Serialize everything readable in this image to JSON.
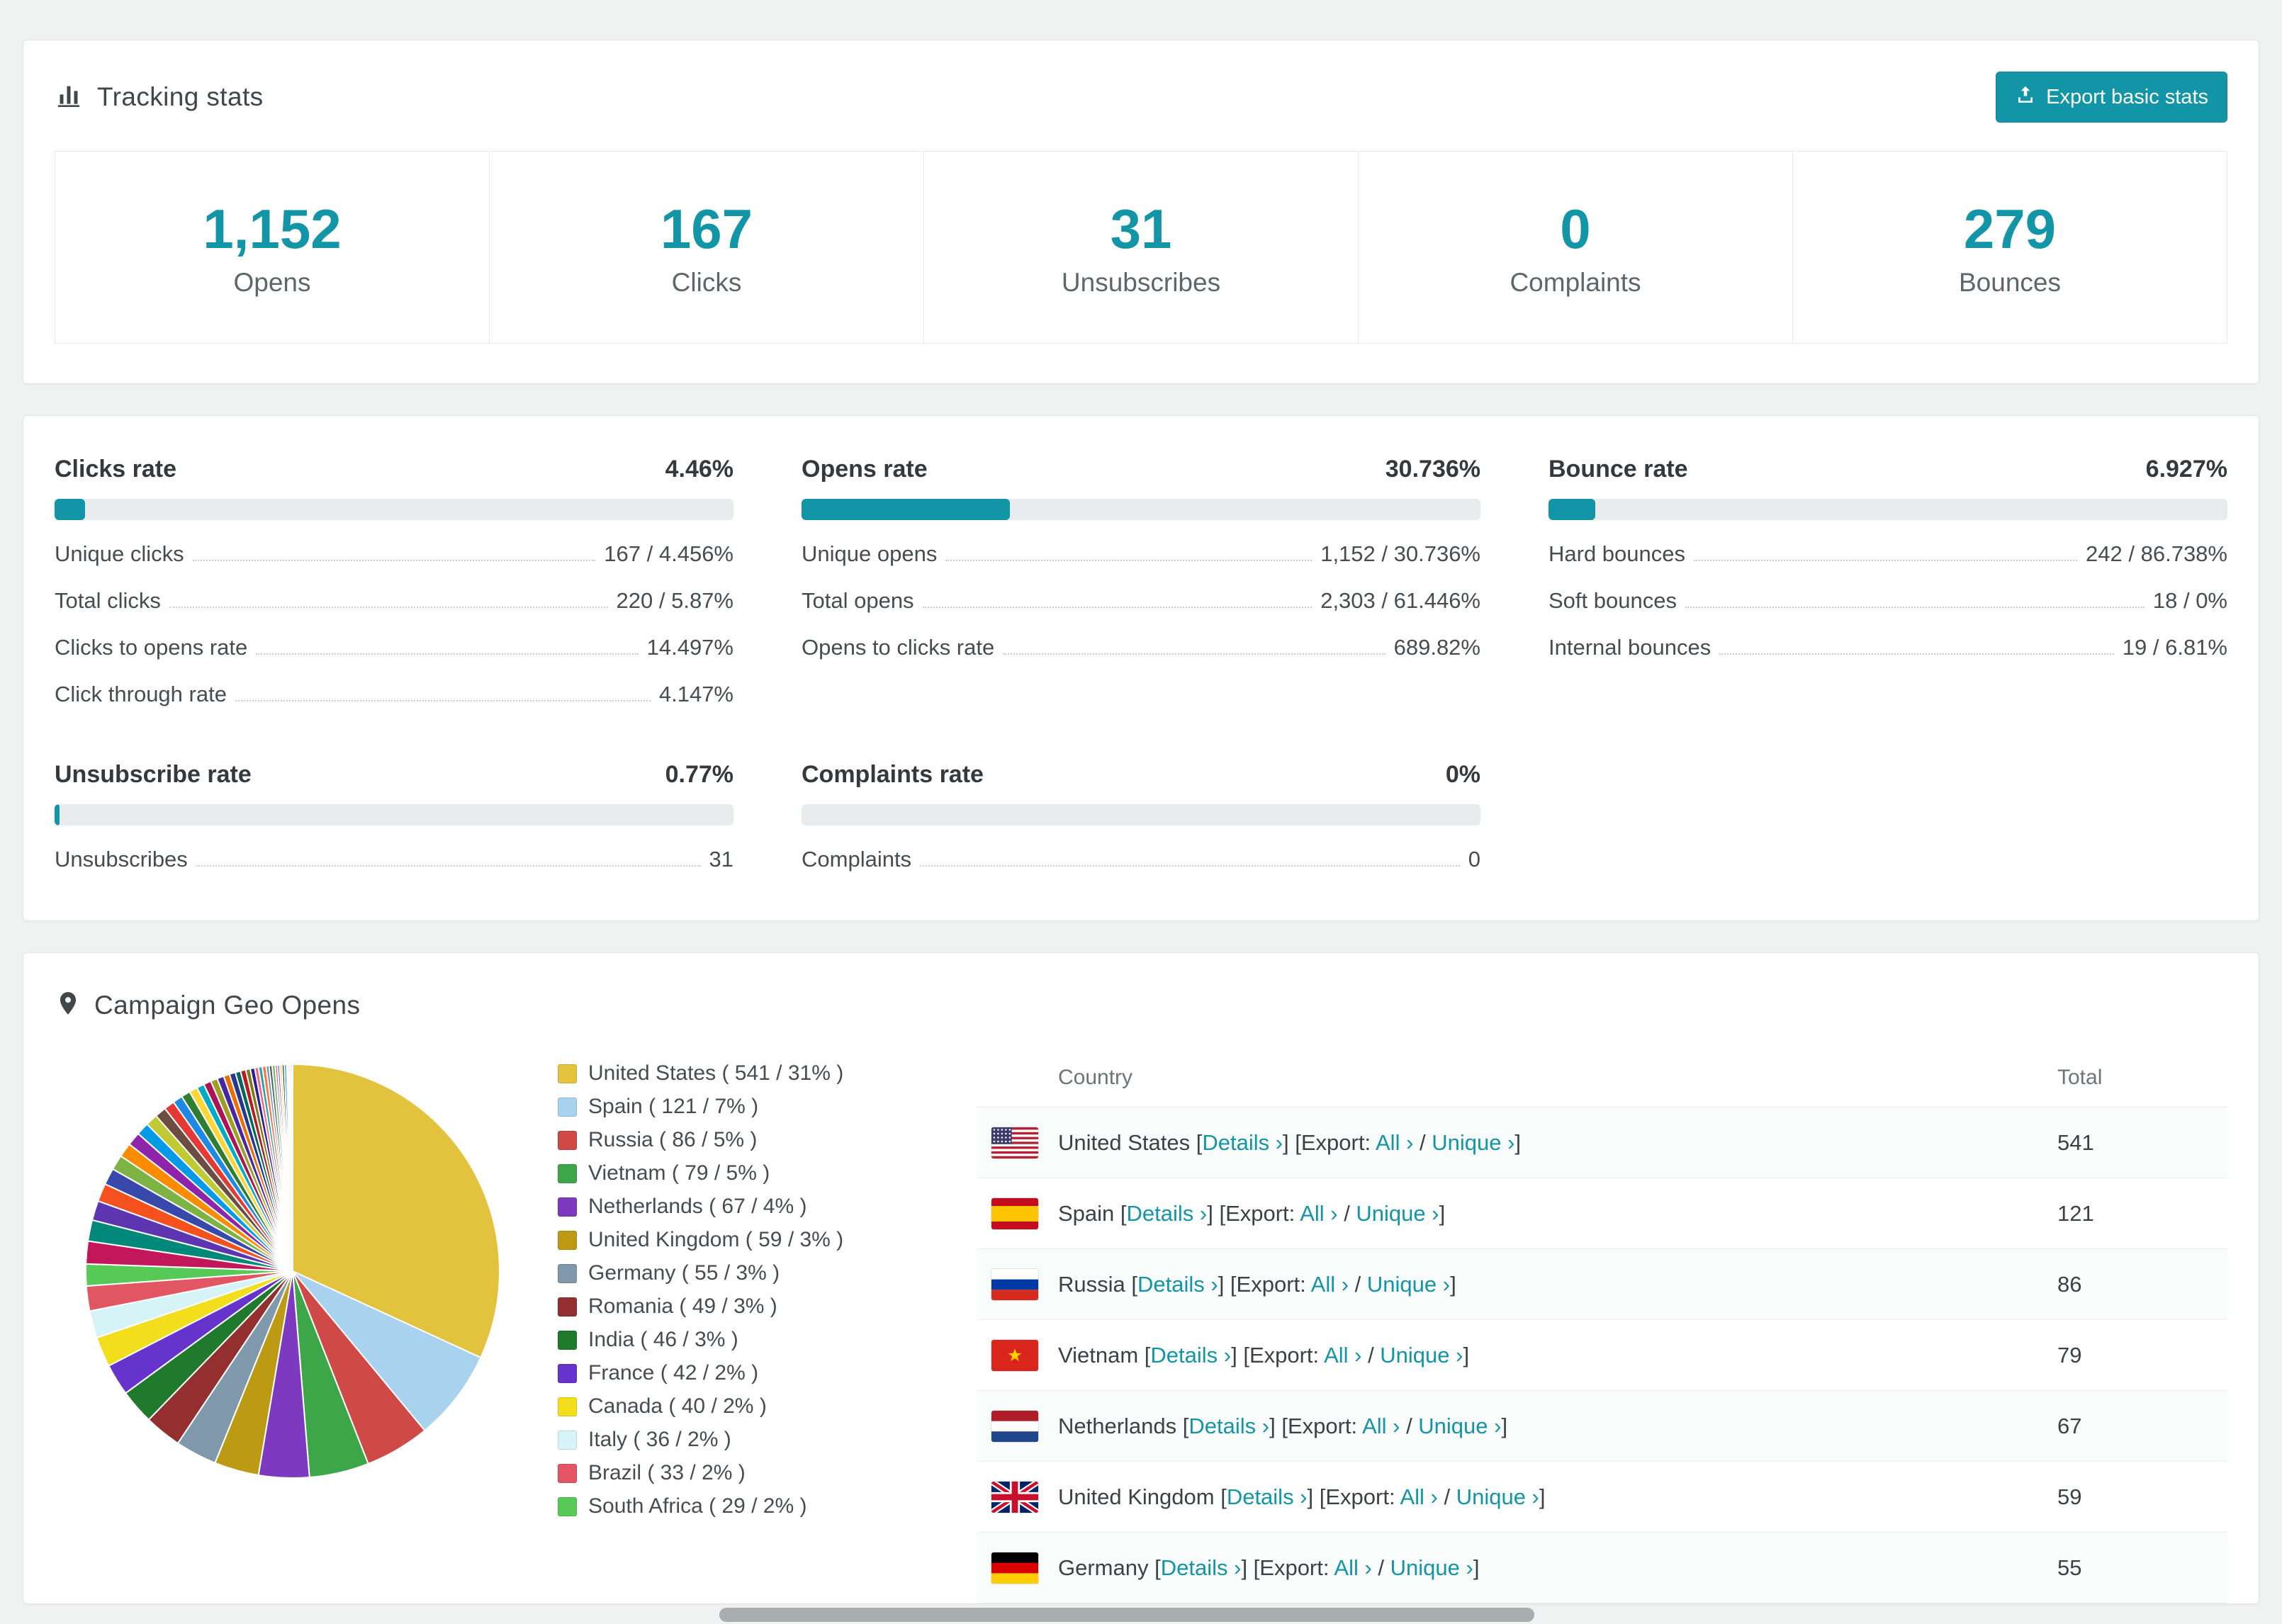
{
  "theme": {
    "accent": "#1295a6",
    "text_dark": "#3b4246",
    "text_muted": "#5d676b",
    "bar_track": "#e9eced"
  },
  "tracking": {
    "title": "Tracking stats",
    "export_label": "Export basic stats",
    "stats": [
      {
        "value": "1,152",
        "label": "Opens"
      },
      {
        "value": "167",
        "label": "Clicks"
      },
      {
        "value": "31",
        "label": "Unsubscribes"
      },
      {
        "value": "0",
        "label": "Complaints"
      },
      {
        "value": "279",
        "label": "Bounces"
      }
    ]
  },
  "rates": [
    {
      "title": "Clicks rate",
      "value": "4.46%",
      "percent": 4.46,
      "rows": [
        {
          "label": "Unique clicks",
          "value": "167 / 4.456%"
        },
        {
          "label": "Total clicks",
          "value": "220 / 5.87%"
        },
        {
          "label": "Clicks to opens rate",
          "value": "14.497%"
        },
        {
          "label": "Click through rate",
          "value": "4.147%"
        }
      ]
    },
    {
      "title": "Opens rate",
      "value": "30.736%",
      "percent": 30.736,
      "rows": [
        {
          "label": "Unique opens",
          "value": "1,152 / 30.736%"
        },
        {
          "label": "Total opens",
          "value": "2,303 / 61.446%"
        },
        {
          "label": "Opens to clicks rate",
          "value": "689.82%"
        }
      ]
    },
    {
      "title": "Bounce rate",
      "value": "6.927%",
      "percent": 6.927,
      "rows": [
        {
          "label": "Hard bounces",
          "value": "242 / 86.738%"
        },
        {
          "label": "Soft bounces",
          "value": "18 / 0%"
        },
        {
          "label": "Internal bounces",
          "value": "19 / 6.81%"
        }
      ]
    },
    {
      "title": "Unsubscribe rate",
      "value": "0.77%",
      "percent": 0.77,
      "rows": [
        {
          "label": "Unsubscribes",
          "value": "31"
        }
      ]
    },
    {
      "title": "Complaints rate",
      "value": "0%",
      "percent": 0,
      "rows": [
        {
          "label": "Complaints",
          "value": "0"
        }
      ]
    }
  ],
  "geo": {
    "title": "Campaign Geo Opens",
    "table": {
      "headers": [
        "Country",
        "Total"
      ],
      "links": {
        "details": "Details ›",
        "export_prefix": "Export:",
        "all": "All ›",
        "separator": "/",
        "unique": "Unique ›"
      },
      "rows": [
        {
          "country": "United States",
          "flag": "us",
          "total": "541"
        },
        {
          "country": "Spain",
          "flag": "es",
          "total": "121"
        },
        {
          "country": "Russia",
          "flag": "ru",
          "total": "86"
        },
        {
          "country": "Vietnam",
          "flag": "vn",
          "total": "79"
        },
        {
          "country": "Netherlands",
          "flag": "nl",
          "total": "67"
        },
        {
          "country": "United Kingdom",
          "flag": "gb",
          "total": "59"
        },
        {
          "country": "Germany",
          "flag": "de",
          "total": "55"
        }
      ]
    },
    "chart_data": {
      "type": "pie",
      "title": "Campaign Geo Opens",
      "legend_position": "right",
      "slices": [
        {
          "label": "United States",
          "value": 541,
          "pct": "31%",
          "color": "#e3c33e",
          "legend": "United States ( 541 / 31% )"
        },
        {
          "label": "Spain",
          "value": 121,
          "pct": "7%",
          "color": "#a8d2ee",
          "legend": "Spain ( 121 / 7% )"
        },
        {
          "label": "Russia",
          "value": 86,
          "pct": "5%",
          "color": "#cf4a47",
          "legend": "Russia ( 86 / 5% )"
        },
        {
          "label": "Vietnam",
          "value": 79,
          "pct": "5%",
          "color": "#3da648",
          "legend": "Vietnam ( 79 / 5% )"
        },
        {
          "label": "Netherlands",
          "value": 67,
          "pct": "4%",
          "color": "#7d3ac1",
          "legend": "Netherlands ( 67 / 4% )"
        },
        {
          "label": "United Kingdom",
          "value": 59,
          "pct": "3%",
          "color": "#bd9a13",
          "legend": "United Kingdom ( 59 / 3% )"
        },
        {
          "label": "Germany",
          "value": 55,
          "pct": "3%",
          "color": "#8098ab",
          "legend": "Germany ( 55 / 3% )"
        },
        {
          "label": "Romania",
          "value": 49,
          "pct": "3%",
          "color": "#942f2f",
          "legend": "Romania ( 49 / 3% )"
        },
        {
          "label": "India",
          "value": 46,
          "pct": "3%",
          "color": "#1f7a2d",
          "legend": "India ( 46 / 3% )"
        },
        {
          "label": "France",
          "value": 42,
          "pct": "2%",
          "color": "#6633cc",
          "legend": "France ( 42 / 2% )"
        },
        {
          "label": "Canada",
          "value": 40,
          "pct": "2%",
          "color": "#f2de1c",
          "legend": "Canada ( 40 / 2% )"
        },
        {
          "label": "Italy",
          "value": 36,
          "pct": "2%",
          "color": "#d6f4f7",
          "legend": "Italy ( 36 / 2% )"
        },
        {
          "label": "Brazil",
          "value": 33,
          "pct": "2%",
          "color": "#e25563",
          "legend": "Brazil ( 33 / 2% )"
        },
        {
          "label": "South Africa",
          "value": 29,
          "pct": "2%",
          "color": "#57c957",
          "legend": "South Africa ( 29 / 2% )"
        }
      ],
      "others": {
        "note": "remaining small countries drawn as thin unlabeled slices",
        "values": [
          30,
          28,
          26,
          24,
          22,
          20,
          19,
          18,
          17,
          16,
          15,
          14,
          13,
          12,
          11,
          10,
          10,
          9,
          9,
          8,
          8,
          7,
          7,
          6,
          6,
          5,
          5,
          5,
          4,
          4,
          4,
          3,
          3,
          3,
          3,
          3,
          2,
          2,
          2,
          2
        ],
        "colors": [
          "#c2185b",
          "#00897b",
          "#5e35b1",
          "#f4511e",
          "#3949ab",
          "#7cb342",
          "#fb8c00",
          "#8e24aa",
          "#039be5",
          "#c0ca33",
          "#6d4c41",
          "#e53935",
          "#1e88e5",
          "#2e7d32",
          "#fdd835",
          "#00acc1",
          "#ad1457",
          "#9e9d24",
          "#4527a0",
          "#ef6c00",
          "#283593",
          "#00695c",
          "#b71c1c",
          "#827717",
          "#311b92",
          "#f06292",
          "#26a69a",
          "#ff7043",
          "#78909c",
          "#455a64",
          "#66bb6a",
          "#ec407a",
          "#7e57c2",
          "#d4e157",
          "#212121",
          "#0097a7",
          "#afb42b",
          "#5d4037",
          "#d81b60",
          "#43a047"
        ]
      }
    }
  }
}
